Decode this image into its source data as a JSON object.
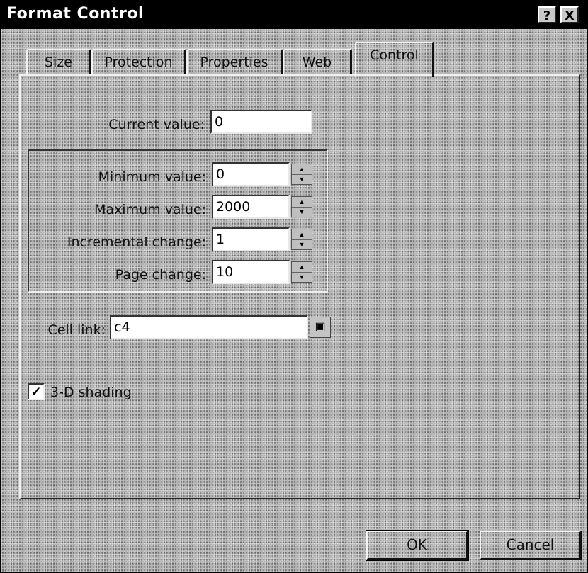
{
  "window": {
    "title": "Format Control"
  },
  "title_buttons": {
    "help": "?",
    "close": "X"
  },
  "tabs": [
    {
      "label": "Size"
    },
    {
      "label": "Protection"
    },
    {
      "label": "Properties"
    },
    {
      "label": "Web"
    },
    {
      "label": "Control",
      "active": true
    }
  ],
  "control": {
    "current_value": {
      "label": "Current value:",
      "value": "0"
    },
    "minimum_value": {
      "label": "Minimum value:",
      "value": "0"
    },
    "maximum_value": {
      "label": "Maximum value:",
      "value": "2000"
    },
    "incremental_change": {
      "label": "Incremental change:",
      "value": "1"
    },
    "page_change": {
      "label": "Page change:",
      "value": "10"
    },
    "cell_link": {
      "label": "Cell link:",
      "value": "c4"
    },
    "shading": {
      "label": "3-D shading",
      "checked": true
    }
  },
  "buttons": {
    "ok": "OK",
    "cancel": "Cancel"
  },
  "icons": {
    "spin_up": "spin-up-icon",
    "spin_down": "spin-down-icon",
    "collapse": "collapse-dialog-icon",
    "check": "checkmark-icon"
  }
}
